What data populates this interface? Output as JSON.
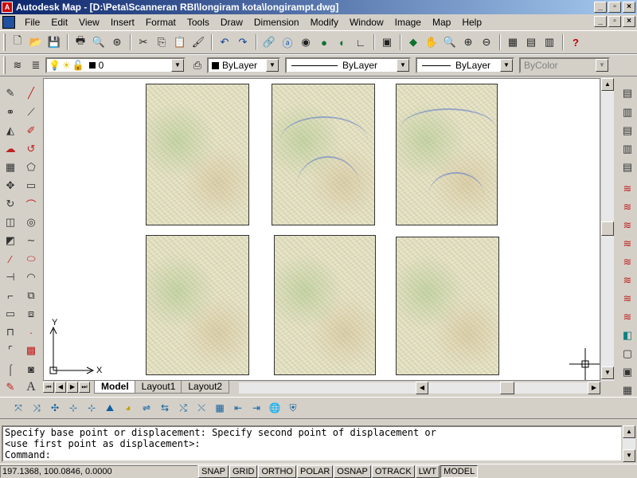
{
  "window": {
    "title": "Autodesk Map - [D:\\Peta\\Scanneran RBI\\longiram kota\\longirampt.dwg]",
    "minimize": "_",
    "maximize": "▫",
    "close": "×"
  },
  "menubar": {
    "items": [
      "File",
      "Edit",
      "View",
      "Insert",
      "Format",
      "Tools",
      "Draw",
      "Dimension",
      "Modify",
      "Window",
      "Image",
      "Map",
      "Help"
    ]
  },
  "layers_toolbar": {
    "layer_value": "0",
    "color_value": "ByLayer",
    "linetype_value": "ByLayer",
    "lineweight_value": "ByLayer",
    "plotstyle_value": "ByColor"
  },
  "icons": {
    "standard": [
      "new-icon",
      "open-icon",
      "save-icon",
      "print-icon",
      "print-preview-icon",
      "publish-icon",
      "cut-icon",
      "copy-icon",
      "paste-icon",
      "match-properties-icon",
      "undo-icon",
      "redo-icon",
      "hyperlink-icon",
      "dbconnect-icon",
      "tracking-icon",
      "map-icon",
      "map-explorer-icon",
      "ucs-icon",
      "layer-icon",
      "pan-icon",
      "zoom-realtime-icon",
      "zoom-window-icon",
      "zoom-previous-icon",
      "properties-icon",
      "design-center-icon",
      "tool-palette-icon",
      "help-icon"
    ]
  },
  "tabs": {
    "items": [
      "Model",
      "Layout1",
      "Layout2"
    ],
    "active": "Model"
  },
  "ucs": {
    "x_label": "X",
    "y_label": "Y"
  },
  "command": {
    "history_1": "Specify base point or displacement: Specify second point of displacement or",
    "history_2": "<use first point as displacement>:",
    "prompt": "Command:"
  },
  "statusbar": {
    "coords": "197.1368, 100.0846, 0.0000",
    "buttons": [
      "SNAP",
      "GRID",
      "ORTHO",
      "POLAR",
      "OSNAP",
      "OTRACK",
      "LWT",
      "MODEL"
    ]
  }
}
